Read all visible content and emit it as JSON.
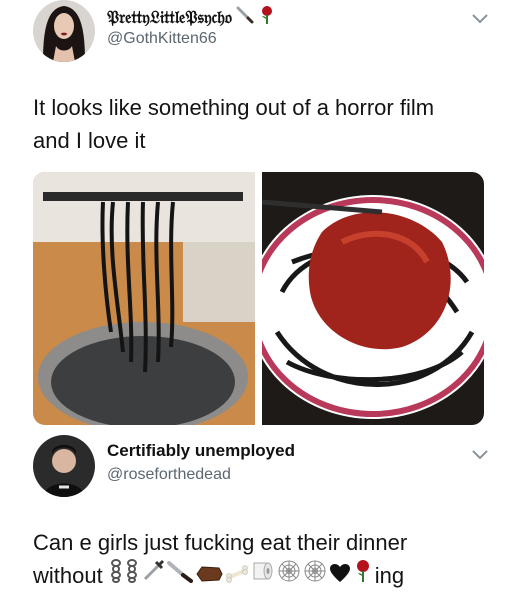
{
  "tweet1": {
    "display_name": "𝔓𝔯𝔢𝔱𝔱𝔶𝔏𝔦𝔱𝔱𝔩𝔢𝔓𝔰𝔶𝔠𝔥𝔬",
    "name_emoji": [
      "knife",
      "rose"
    ],
    "handle": "@GothKitten66",
    "text": "It looks like something out of a horror film and I love it",
    "images": [
      "black-spaghetti-in-pot",
      "black-spaghetti-with-sauce"
    ]
  },
  "tweet2": {
    "display_name": "Certifiably unemployed",
    "handle": "@roseforthedead",
    "text_main": "Can e girls just fucking eat their dinner",
    "text_prefix": "without",
    "text_suffix": "ing",
    "emoji_sequence": [
      "chain",
      "chain",
      "dagger",
      "knife",
      "coffin",
      "bone",
      "toilet-paper",
      "spider-web",
      "spider-web",
      "black-heart",
      "rose"
    ]
  },
  "colors": {
    "name": "#111111",
    "handle": "#5b6670",
    "text": "#141414"
  }
}
